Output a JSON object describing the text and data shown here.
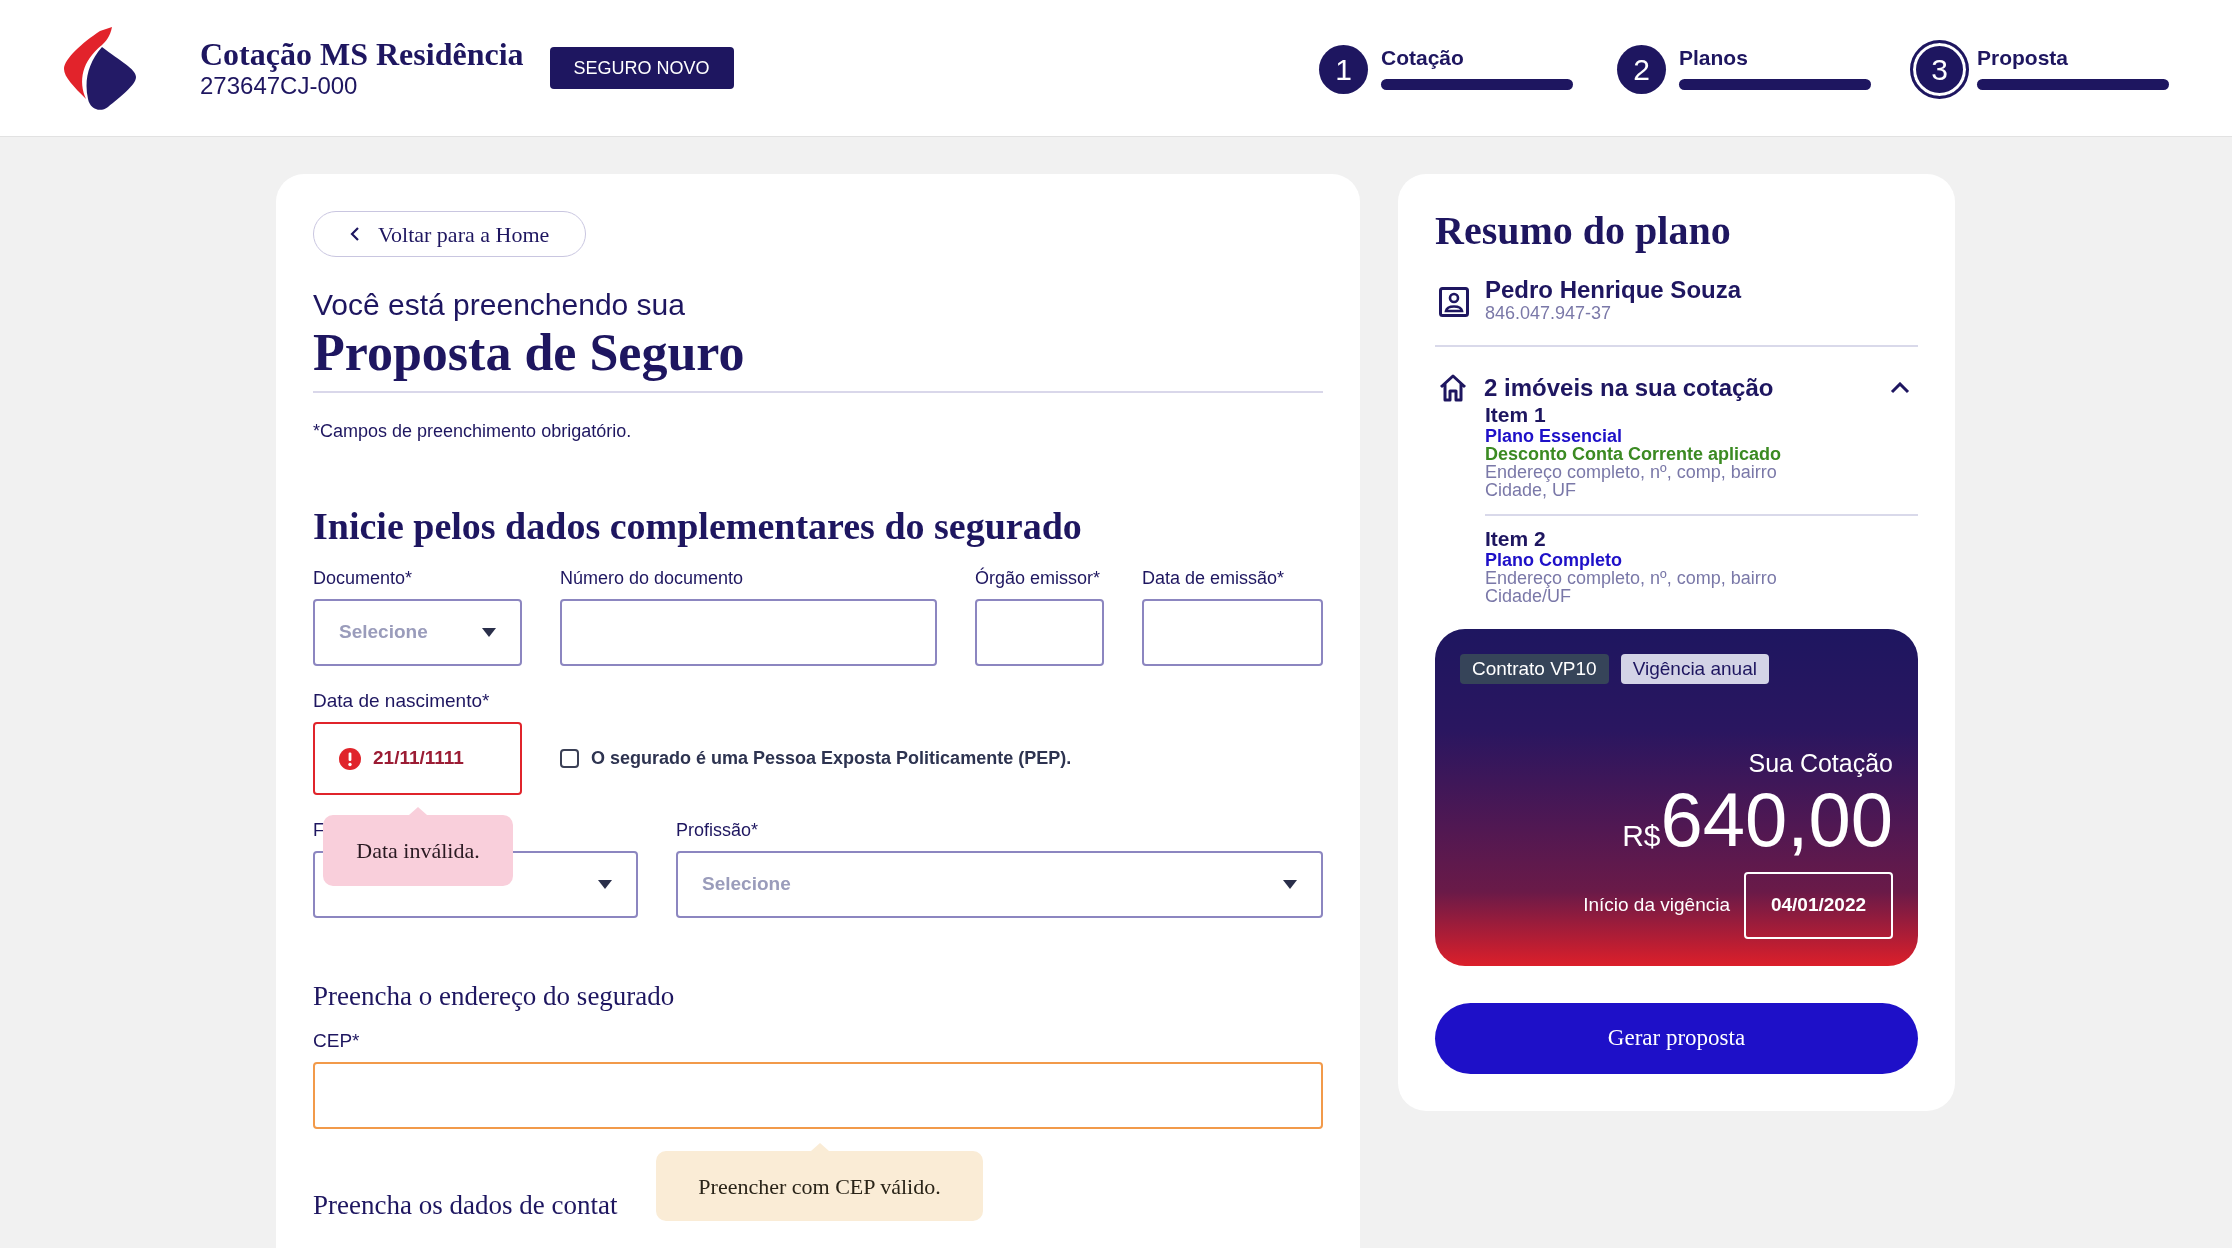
{
  "header": {
    "title": "Cotação MS Residência",
    "code": "273647CJ-000",
    "badge": "SEGURO NOVO"
  },
  "steps": [
    {
      "number": "1",
      "label": "Cotação",
      "selected": false,
      "level": 1
    },
    {
      "number": "2",
      "label": "Planos",
      "selected": false,
      "level": 1
    },
    {
      "number": "3",
      "label": "Proposta",
      "selected": true,
      "level": 1
    }
  ],
  "form": {
    "back_link": "Voltar para a Home",
    "intro": "Você está preenchendo sua",
    "title": "Proposta de Seguro",
    "note": "*Campos de preenchimento obrigatório.",
    "section_title": "Inicie pelos dados complementares do segurado",
    "row1": [
      {
        "label": "Documento*",
        "kind": "select",
        "placeholder": "Selecione"
      },
      {
        "label": "Número do documento",
        "kind": "text"
      },
      {
        "label": "Órgão emissor*",
        "kind": "text"
      },
      {
        "label": "Data de emissão*",
        "kind": "text"
      }
    ],
    "birth_date": {
      "label": "Data de nascimento*",
      "value": "21/11/1111",
      "invalid": true,
      "tooltip": "Data inválida."
    },
    "pep_checkbox": {
      "label": "O segurado é uma Pessoa Exposta Politicamente (PEP).",
      "checked": false
    },
    "row3": [
      {
        "label": "F",
        "kind": "select"
      },
      {
        "label": "Profissão*",
        "kind": "select",
        "placeholder": "Selecione"
      }
    ],
    "address_title": "Preencha o endereço do segurado",
    "cep": {
      "label": "CEP*",
      "warning": true,
      "tooltip": "Preencher com CEP válido."
    },
    "contact_title": "Preencha os dados de contat"
  },
  "summary": {
    "title": "Resumo do plano",
    "person_name": "Pedro Henrique Souza",
    "person_id": "846.047.947-37",
    "properties_title": "2 imóveis na sua cotação",
    "expanded": true,
    "items": [
      {
        "name": "Item 1",
        "plan": "Plano Essencial",
        "discount": "Desconto Conta Corrente aplicado",
        "address": "Endereço completo, nº, comp, bairro",
        "city": "Cidade, UF"
      },
      {
        "name": "Item 2",
        "plan": "Plano Completo",
        "address": "Endereço completo, nº, comp, bairro",
        "city": "Cidade/UF"
      }
    ],
    "tags": [
      {
        "label": "Contrato VP10",
        "kind": "dark"
      },
      {
        "label": "Vigência anual",
        "kind": "light"
      }
    ],
    "quote_label": "Sua Cotação",
    "currency": "R$",
    "price": "640,00",
    "start_label": "Início da vigência",
    "start_date": "04/01/2022",
    "button": "Gerar proposta"
  }
}
